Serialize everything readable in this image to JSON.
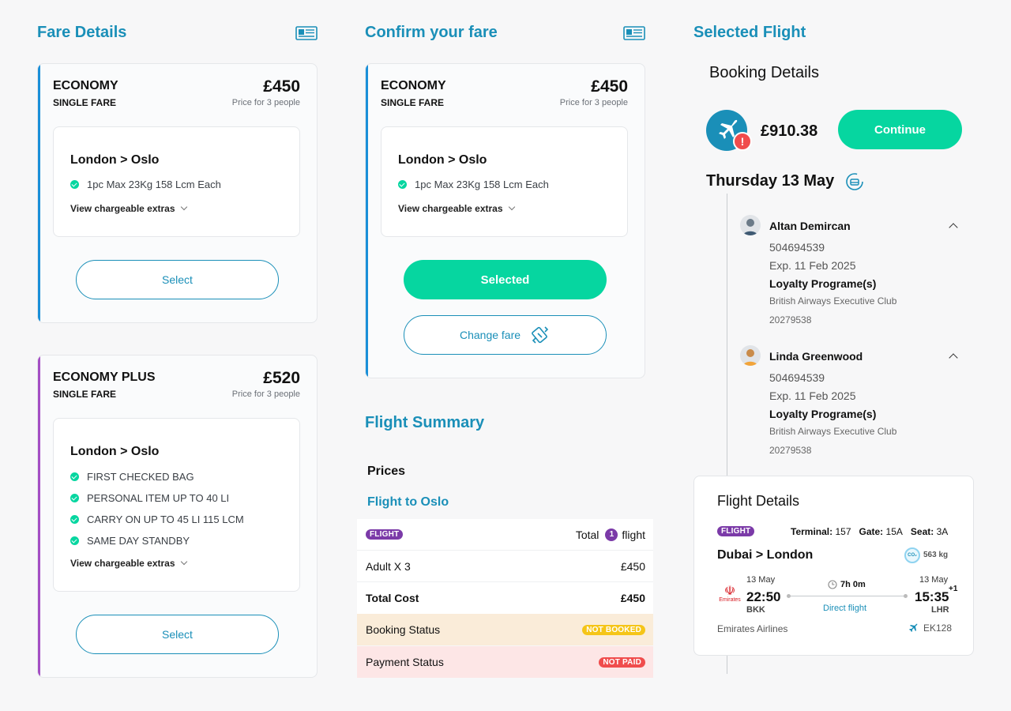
{
  "fare_details": {
    "title": "Fare Details",
    "cards": [
      {
        "name": "ECONOMY",
        "type": "SINGLE FARE",
        "price": "£450",
        "price_note": "Price for 3 people",
        "route": "London > Oslo",
        "features": [
          "1pc Max 23Kg 158 Lcm Each"
        ],
        "extras": "View chargeable extras",
        "button": "Select",
        "accent": "#1a8fd8"
      },
      {
        "name": "ECONOMY PLUS",
        "type": "SINGLE FARE",
        "price": "£520",
        "price_note": "Price for 3 people",
        "route": "London > Oslo",
        "features": [
          "FIRST CHECKED BAG",
          "PERSONAL ITEM UP TO 40 LI",
          "CARRY ON UP TO 45 LI 115 LCM",
          "SAME DAY STANDBY"
        ],
        "extras": "View chargeable extras",
        "button": "Select",
        "accent": "#a44ec4"
      }
    ]
  },
  "confirm": {
    "title": "Confirm your fare",
    "card": {
      "name": "ECONOMY",
      "type": "SINGLE FARE",
      "price": "£450",
      "price_note": "Price for 3 people",
      "route": "London > Oslo",
      "features": [
        "1pc Max 23Kg 158 Lcm Each"
      ],
      "extras": "View chargeable extras",
      "selected_button": "Selected",
      "change_button": "Change fare",
      "accent": "#1a8fd8"
    }
  },
  "summary": {
    "title": "Flight Summary",
    "prices_label": "Prices",
    "flight_to": "Flight to Oslo",
    "flight_badge": "FLIGHT",
    "total_label": "Total",
    "total_count": "1",
    "total_unit": "flight",
    "adult_label": "Adult X 3",
    "adult_value": "£450",
    "total_cost_label": "Total Cost",
    "total_cost_value": "£450",
    "booking_status_label": "Booking Status",
    "booking_status_value": "NOT BOOKED",
    "payment_status_label": "Payment Status",
    "payment_status_value": "NOT PAID"
  },
  "selected": {
    "title": "Selected Flight",
    "booking_details": "Booking Details",
    "price": "£910.38",
    "continue": "Continue",
    "date": "Thursday 13 May",
    "passengers": [
      {
        "name": "Altan Demircan",
        "number": "504694539",
        "exp": "Exp. 11 Feb 2025",
        "loyalty_label": "Loyalty Programe(s)",
        "loyalty_program": "British Airways Executive Club",
        "loyalty_number": "20279538"
      },
      {
        "name": "Linda Greenwood",
        "number": "504694539",
        "exp": "Exp. 11 Feb 2025",
        "loyalty_label": "Loyalty Programe(s)",
        "loyalty_program": "British Airways Executive Club",
        "loyalty_number": "20279538"
      }
    ],
    "flight_details": {
      "title": "Flight Details",
      "badge": "FLIGHT",
      "terminal_label": "Terminal:",
      "terminal": "157",
      "gate_label": "Gate:",
      "gate": "15A",
      "seat_label": "Seat:",
      "seat": "3A",
      "route": "Dubai > London",
      "co2": "563 kg",
      "dep_date": "13 May",
      "dep_time": "22:50",
      "dep_code": "BKK",
      "duration": "7h 0m",
      "direct": "Direct flight",
      "arr_date": "13 May",
      "arr_time": "15:35",
      "arr_plus": "+1",
      "arr_code": "LHR",
      "airline": "Emirates Airlines",
      "airline_logo_text": "Emirates",
      "flight_no": "EK128"
    }
  },
  "colors": {
    "primary": "#1a8fb8",
    "green": "#06d6a0",
    "purple": "#7b3aa8",
    "warn": "#f44",
    "yellow": "#f5c518"
  }
}
